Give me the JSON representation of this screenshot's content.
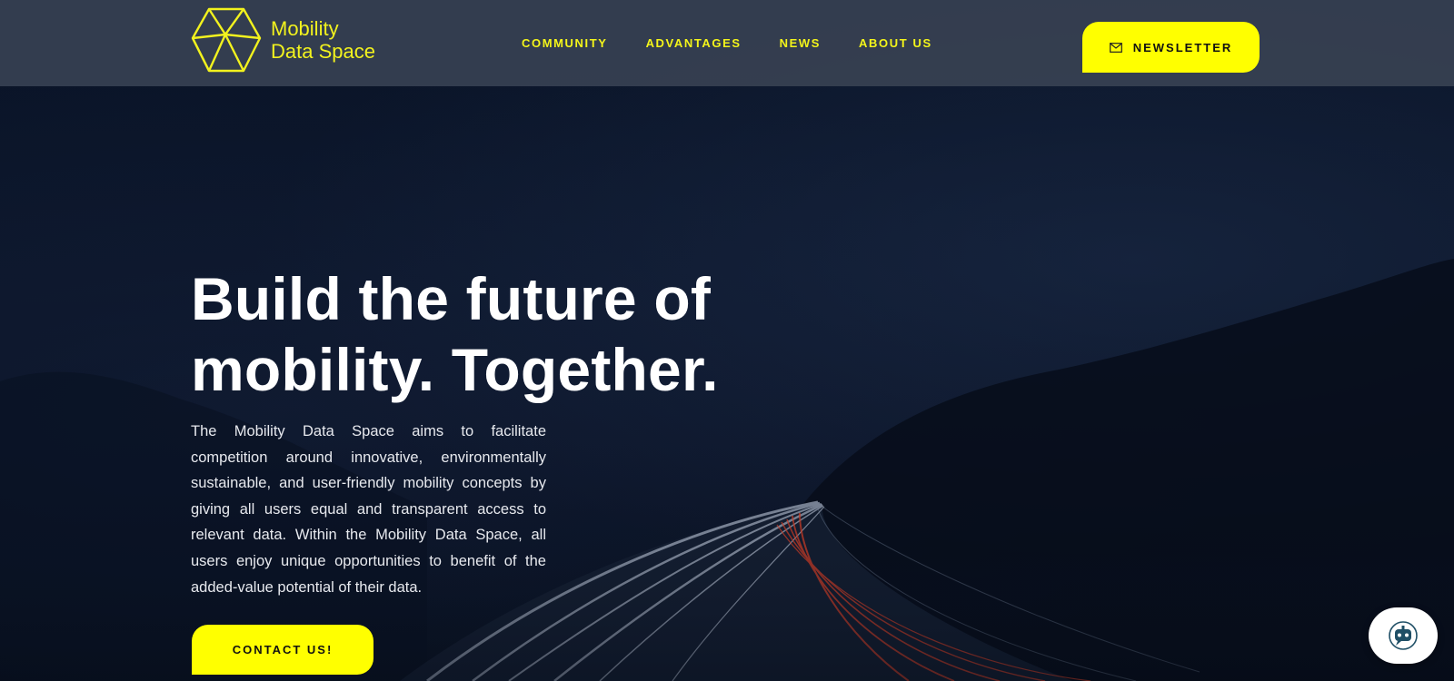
{
  "brand": {
    "name_line1": "Mobility",
    "name_line2": "Data Space",
    "accent_color": "#ffff00"
  },
  "nav": {
    "items": [
      {
        "label": "COMMUNITY"
      },
      {
        "label": "ADVANTAGES"
      },
      {
        "label": "NEWS"
      },
      {
        "label": "ABOUT US"
      }
    ]
  },
  "header": {
    "newsletter_label": "NEWSLETTER",
    "newsletter_icon": "mail-icon"
  },
  "hero": {
    "title_line1": "Build the future of",
    "title_line2": "mobility. Together.",
    "description": "The Mobility Data Space aims to facilitate competition around innovative, environmentally sustainable, and user-friendly mobility concepts by giving all users equal and transparent access to relevant data. Within the Mobility Data Space, all users enjoy unique opportunities to benefit of the added-value potential of their data.",
    "cta_label": "CONTACT US!"
  },
  "chat": {
    "icon": "chatbot-icon"
  }
}
